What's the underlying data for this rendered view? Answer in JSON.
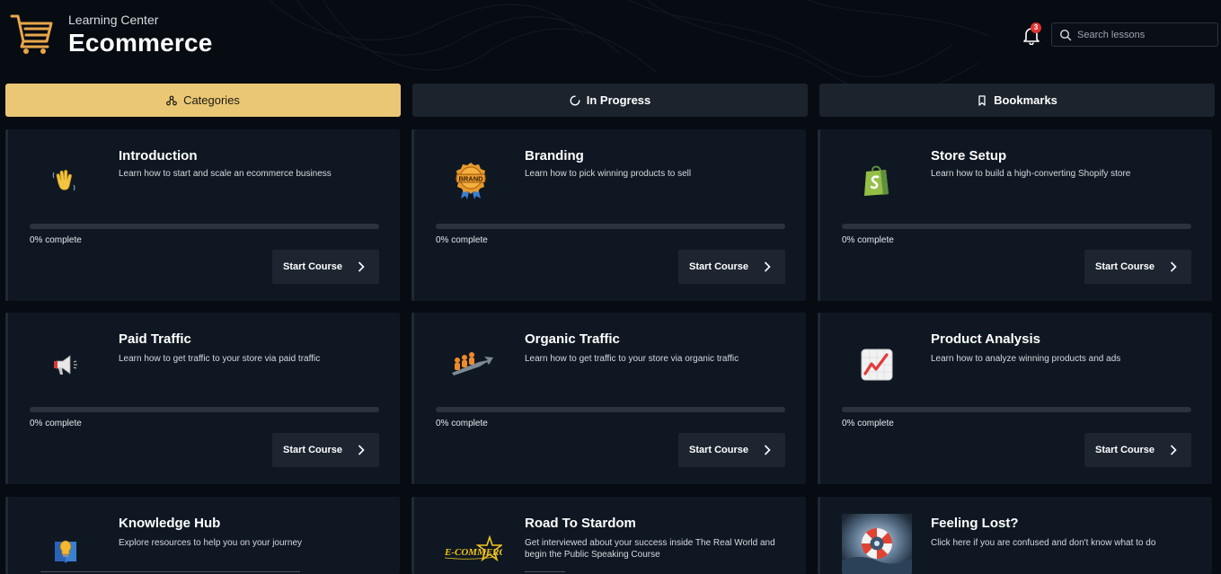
{
  "header": {
    "kicker": "Learning Center",
    "title": "Ecommerce",
    "notification_count": "3",
    "search_placeholder": "Search lessons"
  },
  "tabs": [
    {
      "label": "Categories",
      "icon": "network-icon",
      "active": true
    },
    {
      "label": "In Progress",
      "icon": "spinner-icon",
      "active": false
    },
    {
      "label": "Bookmarks",
      "icon": "bookmark-icon",
      "active": false
    }
  ],
  "courses": [
    {
      "title": "Introduction",
      "description": "Learn how to start and scale an ecommerce business",
      "progress": 0,
      "progress_label": "0% complete",
      "button": "Start Course",
      "icon": "waving-hand-icon"
    },
    {
      "title": "Branding",
      "description": "Learn how to pick winning products to sell",
      "progress": 0,
      "progress_label": "0% complete",
      "button": "Start Course",
      "icon": "brand-badge-icon",
      "icon_text": "BRAND"
    },
    {
      "title": "Store Setup",
      "description": "Learn how to build a high-converting Shopify store",
      "progress": 0,
      "progress_label": "0% complete",
      "button": "Start Course",
      "icon": "shopify-bag-icon"
    },
    {
      "title": "Paid Traffic",
      "description": "Learn how to get traffic to your store via paid traffic",
      "progress": 0,
      "progress_label": "0% complete",
      "button": "Start Course",
      "icon": "megaphone-icon"
    },
    {
      "title": "Organic Traffic",
      "description": "Learn how to get traffic to your store via organic traffic",
      "progress": 0,
      "progress_label": "0% complete",
      "button": "Start Course",
      "icon": "people-growth-icon"
    },
    {
      "title": "Product Analysis",
      "description": "Learn how to analyze winning products and ads",
      "progress": 0,
      "progress_label": "0% complete",
      "button": "Start Course",
      "icon": "chart-up-icon"
    },
    {
      "title": "Knowledge Hub",
      "description": "Explore resources to help you on your journey",
      "icon": "lightbulb-book-icon"
    },
    {
      "title": "Road To Stardom",
      "description": "Get interviewed about your success inside The Real World and begin the Public Speaking Course",
      "icon": "ecommerce-star-logo",
      "icon_text": "E-COMMERCE"
    },
    {
      "title": "Feeling Lost?",
      "description": "Click here if you are confused and don't know what to do",
      "icon": "lifebuoy-image"
    }
  ],
  "colors": {
    "accent": "#eac774",
    "background": "#070b12",
    "card": "#0f1822",
    "badge": "#e0322f"
  }
}
